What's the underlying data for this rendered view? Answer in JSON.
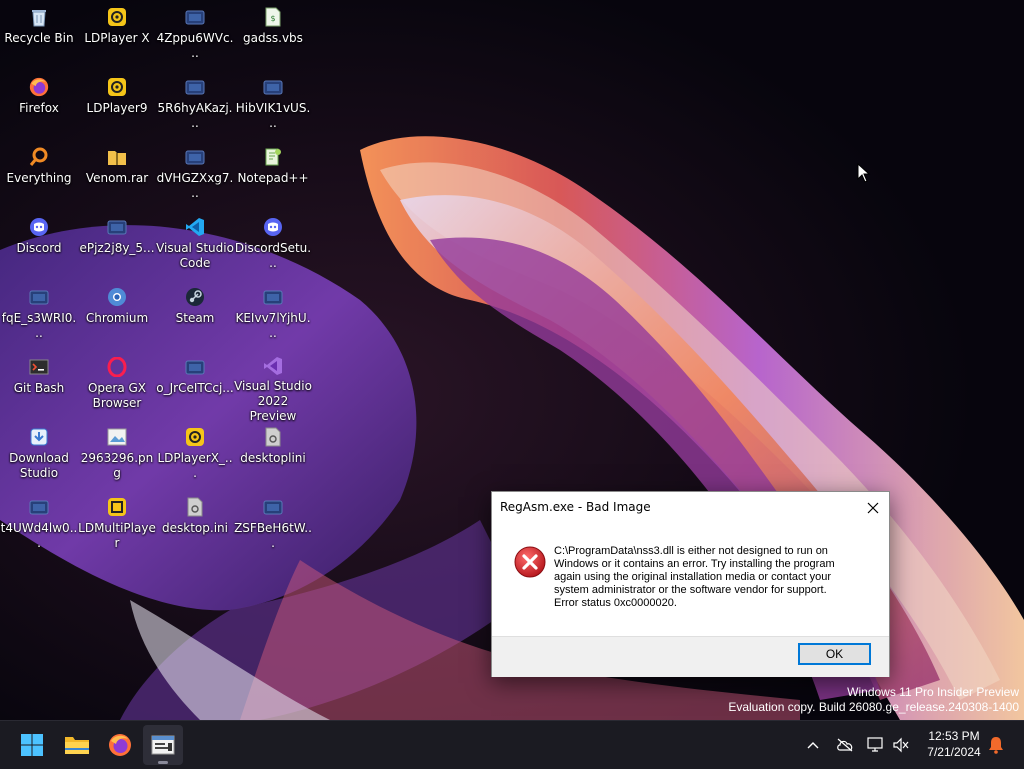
{
  "desktop": {
    "icons": [
      {
        "label": "Recycle Bin",
        "icon": "recycle-bin-icon"
      },
      {
        "label": "LDPlayer X",
        "icon": "ldplayer-icon"
      },
      {
        "label": "4Zppu6WVc...",
        "icon": "file-icon"
      },
      {
        "label": "gadss.vbs",
        "icon": "vbs-script-icon"
      },
      {
        "label": "Firefox",
        "icon": "firefox-icon"
      },
      {
        "label": "LDPlayer9",
        "icon": "ldplayer-icon"
      },
      {
        "label": "5R6hyAKazj...",
        "icon": "file-icon"
      },
      {
        "label": "HibVIK1vUS...",
        "icon": "file-icon"
      },
      {
        "label": "Everything",
        "icon": "everything-search-icon"
      },
      {
        "label": "Venom.rar",
        "icon": "rar-archive-icon"
      },
      {
        "label": "dVHGZXxg7...",
        "icon": "file-icon"
      },
      {
        "label": "Notepad++",
        "icon": "notepad-plus-plus-icon"
      },
      {
        "label": "Discord",
        "icon": "discord-icon"
      },
      {
        "label": "ePjz2j8y_5...",
        "icon": "file-icon"
      },
      {
        "label": "Visual Studio Code",
        "icon": "vscode-icon"
      },
      {
        "label": "DiscordSetu...",
        "icon": "discord-icon"
      },
      {
        "label": "fqE_s3WRI0...",
        "icon": "file-icon"
      },
      {
        "label": "Chromium",
        "icon": "chromium-icon"
      },
      {
        "label": "Steam",
        "icon": "steam-icon"
      },
      {
        "label": "KEIvv7lYjhU...",
        "icon": "file-icon"
      },
      {
        "label": "Git Bash",
        "icon": "git-bash-icon"
      },
      {
        "label": "Opera GX Browser",
        "icon": "opera-gx-icon"
      },
      {
        "label": "o_JrCeITCcj...",
        "icon": "file-icon"
      },
      {
        "label": "Visual Studio 2022 Preview",
        "icon": "visual-studio-icon"
      },
      {
        "label": "Download Studio",
        "icon": "download-studio-icon"
      },
      {
        "label": "2963296.png",
        "icon": "png-image-icon"
      },
      {
        "label": "LDPlayerX_...",
        "icon": "ldplayer-icon"
      },
      {
        "label": "desktoplini",
        "icon": "settings-file-icon"
      },
      {
        "label": "t4UWd4lw0...",
        "icon": "file-icon"
      },
      {
        "label": "LDMultiPlayer",
        "icon": "ldmultiplayer-icon"
      },
      {
        "label": "desktop.ini",
        "icon": "settings-file-icon"
      },
      {
        "label": "ZSFBeH6tW...",
        "icon": "file-icon"
      }
    ]
  },
  "dialog": {
    "title": "RegAsm.exe - Bad Image",
    "message_lines": [
      "C:\\ProgramData\\nss3.dll is either not designed to run on",
      "Windows or it contains an error. Try installing the program",
      "again using the original installation media or contact your",
      "system administrator or the software vendor for support.",
      "Error status 0xc0000020."
    ],
    "ok_label": "OK",
    "icon": "error-icon"
  },
  "watermark": {
    "line1": "Windows 11 Pro Insider Preview",
    "line2": "Evaluation copy. Build 26080.ge_release.240308-1400"
  },
  "taskbar": {
    "apps": [
      {
        "name": "start",
        "icon": "windows-start-icon"
      },
      {
        "name": "file-explorer",
        "icon": "folder-icon"
      },
      {
        "name": "firefox",
        "icon": "firefox-icon"
      },
      {
        "name": "active-window",
        "icon": "app-window-icon"
      }
    ],
    "clock": {
      "time": "12:53 PM",
      "date": "7/21/2024"
    }
  }
}
